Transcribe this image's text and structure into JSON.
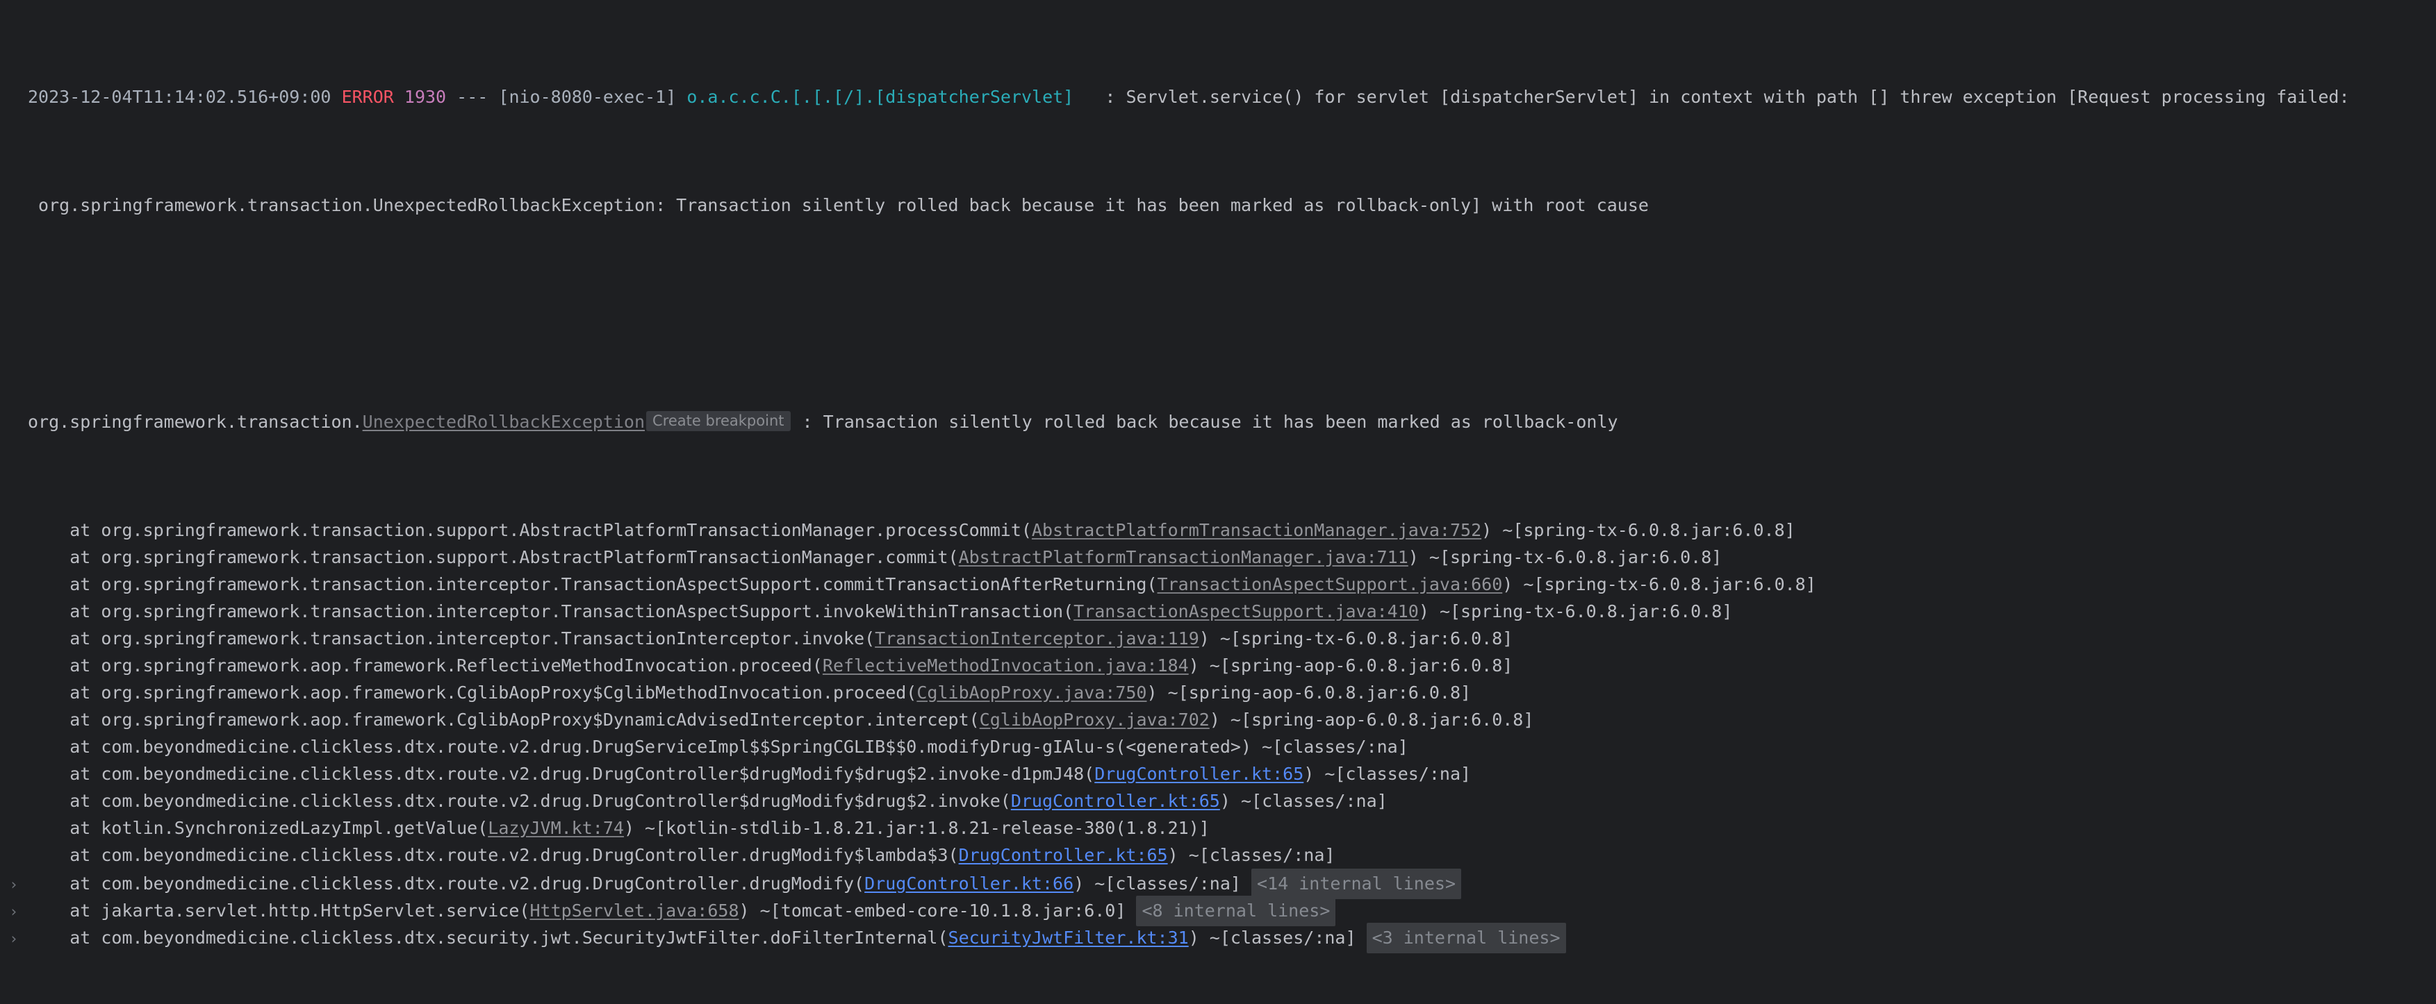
{
  "theme": {
    "background": "#1e1f22",
    "foreground": "#bcbec4",
    "error_color": "#f75464",
    "pid_color": "#c77dbb",
    "logger_color": "#2aacb8",
    "source_link_color": "#548af7",
    "library_link_color": "#939499",
    "chip_background": "#393b40",
    "folded_background": "#3b3d41"
  },
  "header": {
    "timestamp": "2023-12-04T11:14:02.516+09:00",
    "level": "ERROR",
    "pid": "1930",
    "separator": "---",
    "thread": "[nio-8080-exec-1]",
    "logger": "o.a.c.c.C.[.[.[/].[dispatcherServlet]",
    "message_gap": "   : ",
    "message": "Servlet.service() for servlet [dispatcherServlet] in context with path [] threw exception [Request processing failed:",
    "message_continued": " org.springframework.transaction.UnexpectedRollbackException: Transaction silently rolled back because it has been marked as rollback-only] with root cause"
  },
  "exception": {
    "package_prefix": "org.springframework.transaction.",
    "class_name": "UnexpectedRollbackException",
    "breakpoint_chip": "Create breakpoint",
    "detail": " : Transaction silently rolled back because it has been marked as rollback-only"
  },
  "stack_frames": [
    {
      "gutter": "",
      "indent": "    ",
      "at": "at ",
      "frame": "org.springframework.transaction.support.AbstractPlatformTransactionManager.processCommit(",
      "link": "AbstractPlatformTransactionManager.java:752",
      "link_type": "library",
      "suffix": ") ~[spring-tx-6.0.8.jar:6.0.8]",
      "folded": ""
    },
    {
      "gutter": "",
      "indent": "    ",
      "at": "at ",
      "frame": "org.springframework.transaction.support.AbstractPlatformTransactionManager.commit(",
      "link": "AbstractPlatformTransactionManager.java:711",
      "link_type": "library",
      "suffix": ") ~[spring-tx-6.0.8.jar:6.0.8]",
      "folded": ""
    },
    {
      "gutter": "",
      "indent": "    ",
      "at": "at ",
      "frame": "org.springframework.transaction.interceptor.TransactionAspectSupport.commitTransactionAfterReturning(",
      "link": "TransactionAspectSupport.java:660",
      "link_type": "library",
      "suffix": ") ~[spring-tx-6.0.8.jar:6.0.8]",
      "folded": ""
    },
    {
      "gutter": "",
      "indent": "    ",
      "at": "at ",
      "frame": "org.springframework.transaction.interceptor.TransactionAspectSupport.invokeWithinTransaction(",
      "link": "TransactionAspectSupport.java:410",
      "link_type": "library",
      "suffix": ") ~[spring-tx-6.0.8.jar:6.0.8]",
      "folded": ""
    },
    {
      "gutter": "",
      "indent": "    ",
      "at": "at ",
      "frame": "org.springframework.transaction.interceptor.TransactionInterceptor.invoke(",
      "link": "TransactionInterceptor.java:119",
      "link_type": "library",
      "suffix": ") ~[spring-tx-6.0.8.jar:6.0.8]",
      "folded": ""
    },
    {
      "gutter": "",
      "indent": "    ",
      "at": "at ",
      "frame": "org.springframework.aop.framework.ReflectiveMethodInvocation.proceed(",
      "link": "ReflectiveMethodInvocation.java:184",
      "link_type": "library",
      "suffix": ") ~[spring-aop-6.0.8.jar:6.0.8]",
      "folded": ""
    },
    {
      "gutter": "",
      "indent": "    ",
      "at": "at ",
      "frame": "org.springframework.aop.framework.CglibAopProxy$CglibMethodInvocation.proceed(",
      "link": "CglibAopProxy.java:750",
      "link_type": "library",
      "suffix": ") ~[spring-aop-6.0.8.jar:6.0.8]",
      "folded": ""
    },
    {
      "gutter": "",
      "indent": "    ",
      "at": "at ",
      "frame": "org.springframework.aop.framework.CglibAopProxy$DynamicAdvisedInterceptor.intercept(",
      "link": "CglibAopProxy.java:702",
      "link_type": "library",
      "suffix": ") ~[spring-aop-6.0.8.jar:6.0.8]",
      "folded": ""
    },
    {
      "gutter": "",
      "indent": "    ",
      "at": "at ",
      "frame": "com.beyondmedicine.clickless.dtx.route.v2.drug.DrugServiceImpl$$SpringCGLIB$$0.modifyDrug-gIAlu-s(<generated>) ~[classes/:na]",
      "link": "",
      "link_type": "none",
      "suffix": "",
      "folded": ""
    },
    {
      "gutter": "",
      "indent": "    ",
      "at": "at ",
      "frame": "com.beyondmedicine.clickless.dtx.route.v2.drug.DrugController$drugModify$drug$2.invoke-d1pmJ48(",
      "link": "DrugController.kt:65",
      "link_type": "source",
      "suffix": ") ~[classes/:na]",
      "folded": ""
    },
    {
      "gutter": "",
      "indent": "    ",
      "at": "at ",
      "frame": "com.beyondmedicine.clickless.dtx.route.v2.drug.DrugController$drugModify$drug$2.invoke(",
      "link": "DrugController.kt:65",
      "link_type": "source",
      "suffix": ") ~[classes/:na]",
      "folded": ""
    },
    {
      "gutter": "",
      "indent": "    ",
      "at": "at ",
      "frame": "kotlin.SynchronizedLazyImpl.getValue(",
      "link": "LazyJVM.kt:74",
      "link_type": "library",
      "suffix": ") ~[kotlin-stdlib-1.8.21.jar:1.8.21-release-380(1.8.21)]",
      "folded": ""
    },
    {
      "gutter": "",
      "indent": "    ",
      "at": "at ",
      "frame": "com.beyondmedicine.clickless.dtx.route.v2.drug.DrugController.drugModify$lambda$3(",
      "link": "DrugController.kt:65",
      "link_type": "source",
      "suffix": ") ~[classes/:na]",
      "folded": ""
    },
    {
      "gutter": "›",
      "indent": "    ",
      "at": "at ",
      "frame": "com.beyondmedicine.clickless.dtx.route.v2.drug.DrugController.drugModify(",
      "link": "DrugController.kt:66",
      "link_type": "source",
      "suffix": ") ~[classes/:na] ",
      "folded": "<14 internal lines>"
    },
    {
      "gutter": "›",
      "indent": "    ",
      "at": "at ",
      "frame": "jakarta.servlet.http.HttpServlet.service(",
      "link": "HttpServlet.java:658",
      "link_type": "library",
      "suffix": ") ~[tomcat-embed-core-10.1.8.jar:6.0] ",
      "folded": "<8 internal lines>"
    },
    {
      "gutter": "›",
      "indent": "    ",
      "at": "at ",
      "frame": "com.beyondmedicine.clickless.dtx.security.jwt.SecurityJwtFilter.doFilterInternal(",
      "link": "SecurityJwtFilter.kt:31",
      "link_type": "source",
      "suffix": ") ~[classes/:na] ",
      "folded": "<3 internal lines>"
    }
  ]
}
